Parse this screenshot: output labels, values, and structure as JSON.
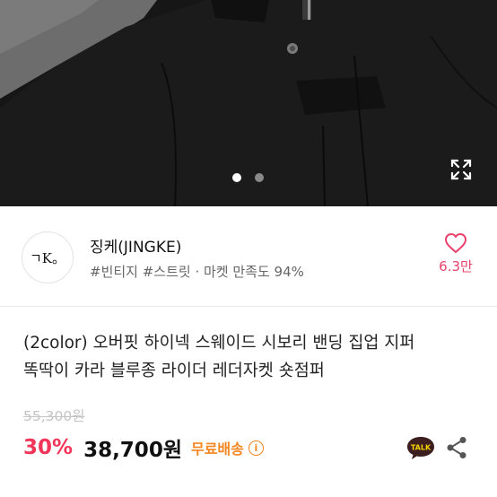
{
  "store": {
    "logo_text": "ㄱK。",
    "name": "징케(JINGKE)",
    "tags": "#빈티지 #스트릿 · 마켓 만족도 94%",
    "like_count": "6.3만"
  },
  "gallery": {
    "total_images": 2,
    "current_index": 1
  },
  "product": {
    "title_line1": "(2color) 오버핏 하이넥 스웨이드 시보리 밴딩 집업 지퍼",
    "title_line2": "똑딱이 카라 블루종 라이더 레더자켓 숏점퍼",
    "original_price": "55,300원",
    "discount": "30%",
    "sale_price": "38,700원",
    "shipping_label": "무료배송"
  },
  "actions": {
    "talk_label": "TALK"
  },
  "colors": {
    "accent_pink": "#e8426b",
    "discount_red": "#f1365a",
    "shipping_orange": "#f5851f",
    "talk_yellow": "#f7d600"
  }
}
